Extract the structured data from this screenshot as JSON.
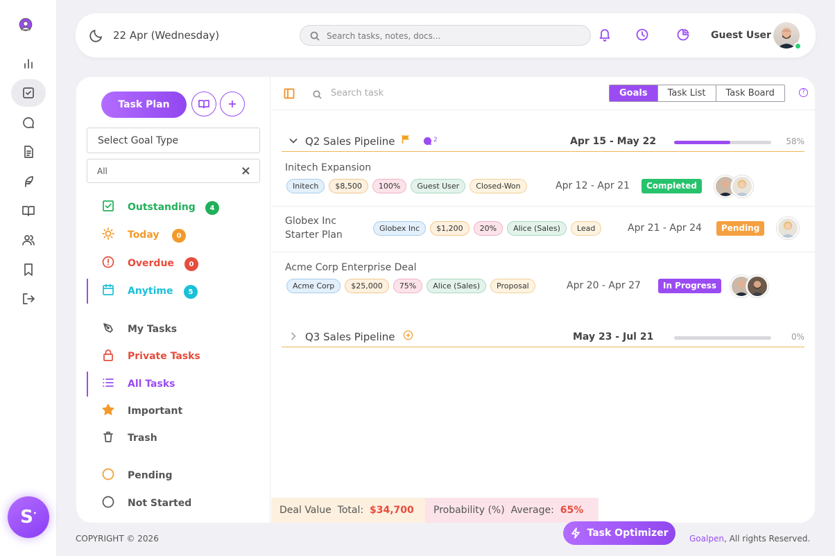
{
  "header": {
    "date": "22 Apr (Wednesday)",
    "search_placeholder": "Search tasks, notes, docs...",
    "user_name": "Guest User"
  },
  "sidebar": {
    "task_plan_label": "Task Plan",
    "select_goal_type": "Select Goal Type",
    "filter_value": "All",
    "status_items": [
      {
        "label": "Outstanding",
        "count": "4",
        "color": "#22b05c"
      },
      {
        "label": "Today",
        "count": "0",
        "color": "#f39a2b"
      },
      {
        "label": "Overdue",
        "count": "0",
        "color": "#e74c3c"
      },
      {
        "label": "Anytime",
        "count": "5",
        "color": "#1ac0d8"
      }
    ],
    "list_items": [
      {
        "label": "My Tasks",
        "color": "#555555"
      },
      {
        "label": "Private Tasks",
        "color": "#e74c3c"
      },
      {
        "label": "All Tasks",
        "color": "#9a4cf2"
      },
      {
        "label": "Important",
        "color": "#555555"
      },
      {
        "label": "Trash",
        "color": "#555555"
      }
    ],
    "state_items": [
      {
        "label": "Pending",
        "color": "#f39a2b"
      },
      {
        "label": "Not Started",
        "color": "#555555"
      }
    ]
  },
  "toolbar": {
    "search_placeholder": "Search task",
    "views": [
      "Goals",
      "Task List",
      "Task Board"
    ],
    "active_view": "Goals",
    "help": "?"
  },
  "pipelines": [
    {
      "title": "Q2 Sales Pipeline",
      "comments": "2",
      "range": "Apr 15 - May 22",
      "progress": 58,
      "progress_label": "58%"
    },
    {
      "title": "Q3 Sales Pipeline",
      "range": "May 23 - Jul 21",
      "progress": 0,
      "progress_label": "0%"
    }
  ],
  "deals": [
    {
      "name": "Initech Expansion",
      "tags": [
        "Initech",
        "$8,500",
        "100%",
        "Guest User",
        "Closed-Won"
      ],
      "dates": "Apr 12 - Apr 21",
      "status": "Completed",
      "status_color": "#27c26c"
    },
    {
      "name": "Globex Inc Starter Plan",
      "name_line1": "Globex Inc",
      "name_line2": "Starter Plan",
      "tags": [
        "Globex Inc",
        "$1,200",
        "20%",
        "Alice (Sales)",
        "Lead"
      ],
      "dates": "Apr 21 - Apr 24",
      "status": "Pending",
      "status_color": "#f5a040"
    },
    {
      "name": "Acme Corp Enterprise Deal",
      "tags": [
        "Acme Corp",
        "$25,000",
        "75%",
        "Alice (Sales)",
        "Proposal"
      ],
      "dates": "Apr 20 - Apr 27",
      "status": "In Progress",
      "status_color": "#9a4cf2"
    }
  ],
  "summary": {
    "deal_label": "Deal Value",
    "total_label": "Total:",
    "total_value": "$34,700",
    "prob_label": "Probability (%)",
    "avg_label": "Average:",
    "avg_value": "65%"
  },
  "footer": {
    "copyright": "COPYRIGHT © 2026",
    "optimizer": "Task Optimizer",
    "brand": "Goalpen",
    "rights": ", All rights Reserved."
  },
  "s_button": "S"
}
